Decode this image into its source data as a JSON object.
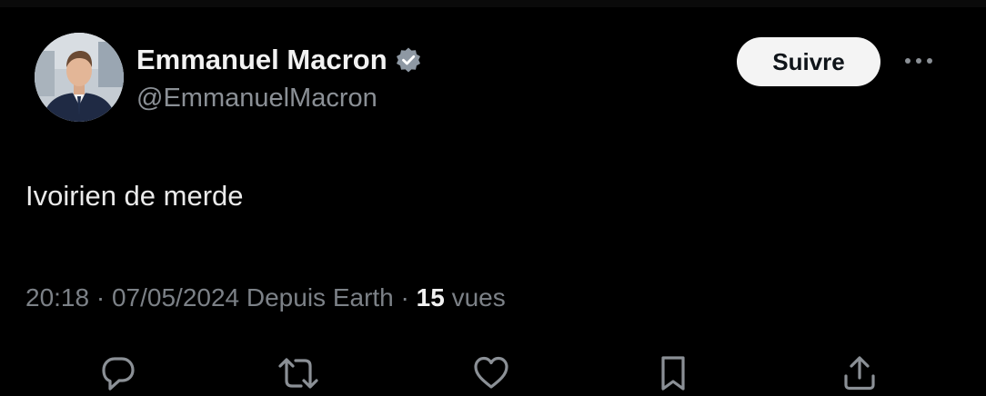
{
  "author": {
    "display_name": "Emmanuel Macron",
    "handle": "@EmmanuelMacron",
    "verified": true
  },
  "follow_button": {
    "label": "Suivre"
  },
  "more_button": {
    "icon": "ellipsis-icon"
  },
  "tweet": {
    "text": "Ivoirien de merde",
    "time": "20:18",
    "separator": "·",
    "date": "07/05/2024",
    "source": "Depuis Earth",
    "views_count": "15",
    "views_label": "vues"
  },
  "actions": [
    {
      "name": "reply",
      "icon": "reply-icon"
    },
    {
      "name": "retweet",
      "icon": "retweet-icon"
    },
    {
      "name": "like",
      "icon": "heart-icon"
    },
    {
      "name": "bookmark",
      "icon": "bookmark-icon"
    },
    {
      "name": "share",
      "icon": "share-icon"
    }
  ],
  "colors": {
    "background": "#000000",
    "name_text": "#f2f2f2",
    "secondary_text": "#8b9096",
    "button_bg": "#f4f4f4",
    "verified_badge": "#8e98a3"
  }
}
